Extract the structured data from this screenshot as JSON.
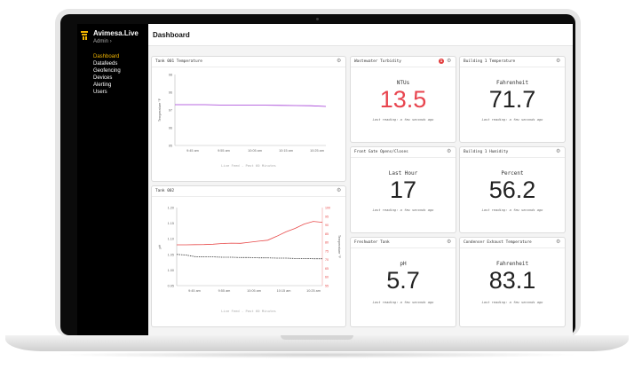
{
  "app": {
    "brand": "Avimesa.Live",
    "role": "Admin",
    "page_title": "Dashboard",
    "nav": [
      {
        "label": "Dashboard",
        "active": true
      },
      {
        "label": "Datafeeds",
        "active": false
      },
      {
        "label": "Geofencing",
        "active": false
      },
      {
        "label": "Devices",
        "active": false
      },
      {
        "label": "Alerting",
        "active": false
      },
      {
        "label": "Users",
        "active": false
      }
    ]
  },
  "colors": {
    "accent": "#f0b400",
    "alert_red": "#e8454f",
    "line_purple": "#a23ad6",
    "line_red": "#e84a4a"
  },
  "cards": {
    "wastewater": {
      "title": "Wastewater Turbidity",
      "unit": "NTUs",
      "value": "13.5",
      "last": "Last reading: a few seconds ago",
      "alert_count": "1"
    },
    "bldg_temp": {
      "title": "Building 1 Temperature",
      "unit": "Fahrenheit",
      "value": "71.7",
      "last": "Last reading: a few seconds ago"
    },
    "gate": {
      "title": "Front Gate Opens/Closes",
      "unit": "Last Hour",
      "value": "17",
      "last": "Last reading: a few seconds ago"
    },
    "bldg_hum": {
      "title": "Building 1 Humidity",
      "unit": "Percent",
      "value": "56.2",
      "last": "Last reading: a few seconds ago"
    },
    "freshwater": {
      "title": "Freshwater Tank",
      "unit": "pH",
      "value": "5.7",
      "last": "Last reading: a few seconds ago"
    },
    "condenser": {
      "title": "Condenser Exhaust Temperature",
      "unit": "Fahrenheit",
      "value": "83.1",
      "last": "Last reading: a few seconds ago"
    }
  },
  "chart_data": [
    {
      "type": "line",
      "title": "Tank 001 Temperature",
      "ylabel": "Temperature °F",
      "caption": "Live Feed - Past 60 Minutes",
      "x_ticks": [
        "9:45 am",
        "9:55 am",
        "10:05 am",
        "10:15 am",
        "10:25 am"
      ],
      "y_ticks": [
        "98",
        "96",
        "97",
        "96",
        "95"
      ],
      "ylim": [
        95,
        99
      ],
      "series": [
        {
          "color": "#a23ad6",
          "values": [
            97.3,
            97.3,
            97.3,
            97.28,
            97.28,
            97.27,
            97.27,
            97.26,
            97.25,
            97.24,
            97.2
          ]
        }
      ]
    },
    {
      "type": "line",
      "title": "Tank 002",
      "ylabel_left": "pH",
      "ylabel_right": "Temperature °F",
      "caption": "Live Feed - Past 60 Minutes",
      "x_ticks": [
        "9:45 am",
        "9:55 am",
        "10:05 am",
        "10:15 am",
        "10:25 am"
      ],
      "y_ticks_left": [
        "1.20",
        "1.15",
        "1.10",
        "1.05",
        "1.00",
        "0.95"
      ],
      "y_ticks_right": [
        "100",
        "95",
        "90",
        "85",
        "80",
        "75",
        "70",
        "65",
        "60",
        "55"
      ],
      "series": [
        {
          "color": "#e84a4a",
          "axis": "right",
          "values": [
            78.5,
            78.5,
            78.6,
            78.7,
            78.9,
            79.3,
            79.5,
            79.4,
            80.0,
            80.6,
            81.2,
            83.5,
            86.0,
            88.0,
            90.5,
            92.0,
            91.5
          ]
        },
        {
          "color": "#333333",
          "axis": "left",
          "dashed": true,
          "values": [
            1.05,
            1.048,
            1.043,
            1.042,
            1.042,
            1.041,
            1.041,
            1.04,
            1.04,
            1.039,
            1.039,
            1.038,
            1.038,
            1.037,
            1.037,
            1.036,
            1.036
          ]
        }
      ]
    }
  ]
}
